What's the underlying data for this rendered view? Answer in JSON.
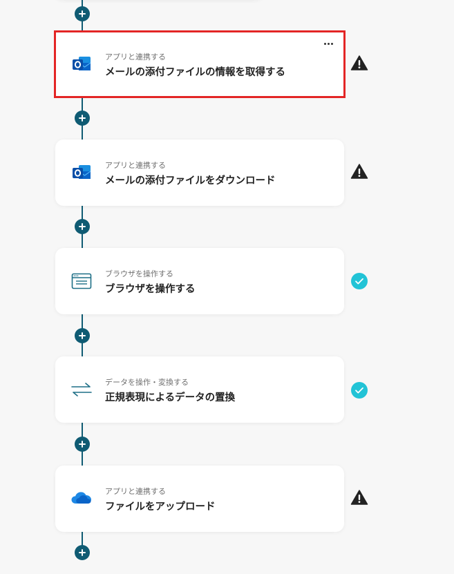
{
  "flow": {
    "steps": [
      {
        "category": "アプリと連携する",
        "title": "メールの添付ファイルの情報を取得する",
        "icon": "outlook-icon",
        "status": "warning",
        "selected": true
      },
      {
        "category": "アプリと連携する",
        "title": "メールの添付ファイルをダウンロード",
        "icon": "outlook-icon",
        "status": "warning",
        "selected": false
      },
      {
        "category": "ブラウザを操作する",
        "title": "ブラウザを操作する",
        "icon": "browser-icon",
        "status": "success",
        "selected": false
      },
      {
        "category": "データを操作・変換する",
        "title": "正規表現によるデータの置換",
        "icon": "transform-arrows-icon",
        "status": "success",
        "selected": false
      },
      {
        "category": "アプリと連携する",
        "title": "ファイルをアップロード",
        "icon": "onedrive-icon",
        "status": "warning",
        "selected": false
      }
    ],
    "add_step_icon": "plus-icon",
    "more_menu_icon": "more-horizontal-icon"
  },
  "colors": {
    "connector": "#0f5b73",
    "selected_border": "#e32525",
    "warning": "#222222",
    "success": "#22c3d6",
    "outlook_blue": "#0a64c8",
    "onedrive_blue": "#1e88e5",
    "browser_stroke": "#1d6e86",
    "arrows_stroke": "#1d6e86"
  }
}
